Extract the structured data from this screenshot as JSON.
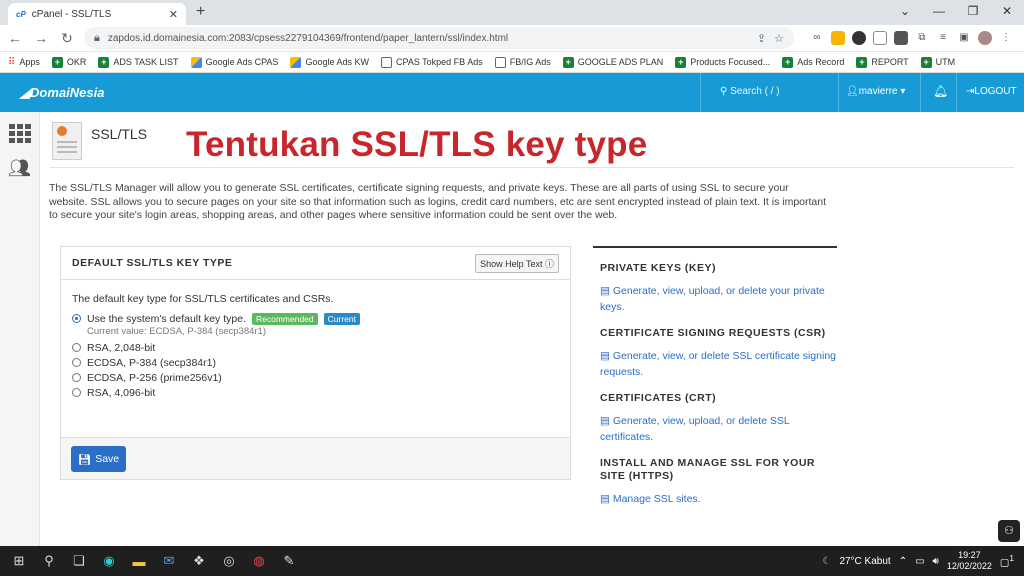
{
  "browser": {
    "tab_title": "cPanel - SSL/TLS",
    "tab_favicon": "cP",
    "url": "zapdos.id.domainesia.com:2083/cpsess2279104369/frontend/paper_lantern/ssl/index.html",
    "bookmarks": [
      "Apps",
      "OKR",
      "ADS TASK LIST",
      "Google Ads CPAS",
      "Google Ads KW",
      "CPAS Tokped FB Ads",
      "FB/IG Ads",
      "GOOGLE ADS PLAN",
      "Products Focused...",
      "Ads Record",
      "REPORT",
      "UTM"
    ]
  },
  "topnav": {
    "logo": "DomaiNesia",
    "search": "Search ( / )",
    "user": "mavierre",
    "logout": "LOGOUT"
  },
  "page": {
    "title": "SSL/TLS",
    "overlay_heading": "Tentukan SSL/TLS key type",
    "intro": "The SSL/TLS Manager will allow you to generate SSL certificates, certificate signing requests, and private keys. These are all parts of using SSL to secure your website. SSL allows you to secure pages on your site so that information such as logins, credit card numbers, etc are sent encrypted instead of plain text. It is important to secure your site's login areas, shopping areas, and other pages where sensitive information could be sent over the web."
  },
  "panel": {
    "title": "DEFAULT SSL/TLS KEY TYPE",
    "help_button": "Show Help Text",
    "description": "The default key type for SSL/TLS certificates and CSRs.",
    "option_default": "Use the system's default key type.",
    "badge_recommended": "Recommended",
    "badge_current": "Current",
    "current_value": "Current value: ECDSA, P-384 (secp384r1)",
    "options": [
      "RSA, 2,048-bit",
      "ECDSA, P-384 (secp384r1)",
      "ECDSA, P-256 (prime256v1)",
      "RSA, 4,096-bit"
    ],
    "save": "Save"
  },
  "right": {
    "private_keys_head": "PRIVATE KEYS (KEY)",
    "private_keys_link": "Generate, view, upload, or delete your private keys.",
    "csr_head": "CERTIFICATE SIGNING REQUESTS (CSR)",
    "csr_link": "Generate, view, or delete SSL certificate signing requests.",
    "crt_head": "CERTIFICATES (CRT)",
    "crt_link": "Generate, view, upload, or delete SSL certificates.",
    "install_head": "INSTALL AND MANAGE SSL FOR YOUR SITE (HTTPS)",
    "install_link": "Manage SSL sites."
  },
  "taskbar": {
    "weather": "27°C  Kabut",
    "time": "19:27",
    "date": "12/02/2022",
    "notifications": "1"
  }
}
